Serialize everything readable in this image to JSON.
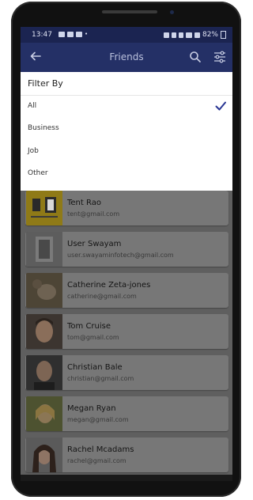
{
  "status": {
    "time": "13:47",
    "battery": "82%"
  },
  "appbar": {
    "title": "Friends"
  },
  "filter": {
    "header": "Filter By",
    "options": [
      {
        "label": "All",
        "selected": true
      },
      {
        "label": "Business",
        "selected": false
      },
      {
        "label": "Job",
        "selected": false
      },
      {
        "label": "Other",
        "selected": false
      }
    ]
  },
  "contacts": [
    {
      "name": "Tent Rao",
      "email": "tent@gmail.com"
    },
    {
      "name": "User Swayam",
      "email": "user.swayaminfotech@gmail.com"
    },
    {
      "name": "Catherine  Zeta-jones",
      "email": "catherine@gmail.com"
    },
    {
      "name": "Tom Cruise",
      "email": "tom@gmail.com"
    },
    {
      "name": "Christian  Bale",
      "email": "christian@gmail.com"
    },
    {
      "name": "Megan  Ryan",
      "email": "megan@gmail.com"
    },
    {
      "name": "Rachel  Mcadams",
      "email": "rachel@gmail.com"
    }
  ],
  "colors": {
    "appbar": "#243066",
    "accent": "#283593"
  }
}
